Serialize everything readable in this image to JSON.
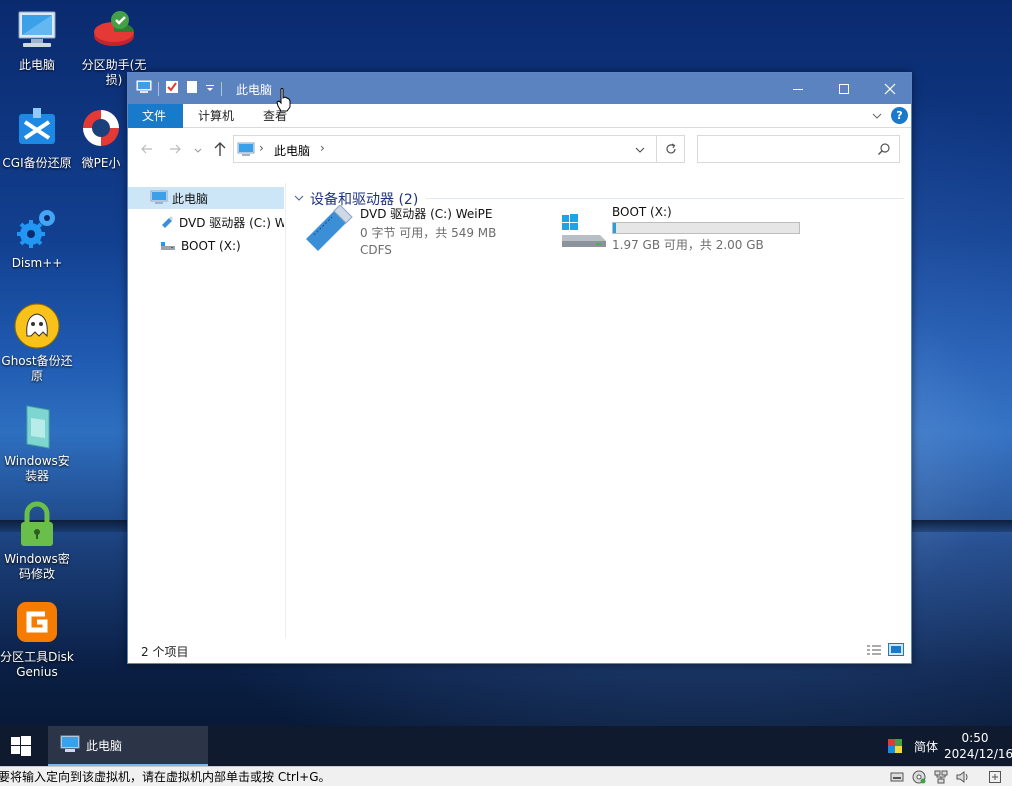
{
  "desktop": {
    "icons": [
      {
        "label": "此电脑",
        "icon": "computer-icon"
      },
      {
        "label": "分区助手(无损)",
        "icon": "partition-assistant-icon"
      },
      {
        "label": "CGI备份还原",
        "icon": "cgi-backup-icon"
      },
      {
        "label": "微PE小",
        "icon": "lifebuoy-icon"
      },
      {
        "label": "Dism++",
        "icon": "gears-icon"
      },
      {
        "label": "Ghost备份还原",
        "icon": "ghost-icon"
      },
      {
        "label": "Windows安装器",
        "icon": "windows-installer-icon"
      },
      {
        "label": "Windows密码修改",
        "icon": "padlock-icon"
      },
      {
        "label": "分区工具DiskGenius",
        "icon": "diskgenius-icon"
      }
    ]
  },
  "window": {
    "title": "此电脑",
    "controls": {
      "minimize": "minimize-icon",
      "maximize": "maximize-icon",
      "close": "close-icon"
    },
    "ribbon_tabs": [
      "文件",
      "计算机",
      "查看"
    ],
    "address": {
      "path": "此电脑"
    },
    "search": {
      "placeholder": ""
    },
    "nav_pane": [
      {
        "label": "此电脑",
        "icon": "computer-icon",
        "selected": true
      },
      {
        "label": "DVD 驱动器 (C:) W",
        "icon": "usb-drive-icon"
      },
      {
        "label": "BOOT (X:)",
        "icon": "drive-icon"
      }
    ],
    "group_header": "设备和驱动器 (2)",
    "drives": [
      {
        "name": "DVD 驱动器 (C:) WeiPE",
        "line2": "0 字节 可用，共 549 MB",
        "line3": "CDFS",
        "icon": "usb-drive-icon"
      },
      {
        "name": "BOOT (X:)",
        "line2": "1.97 GB 可用，共 2.00 GB",
        "icon": "windows-drive-icon",
        "used_fraction": 0.015
      }
    ],
    "status": "2 个项目"
  },
  "taskbar": {
    "app_label": "此电脑",
    "ime": "简体",
    "time": "0:50",
    "date": "2024/12/16"
  },
  "vm_hint": "要将输入定向到该虚拟机，请在虚拟机内部单击或按 Ctrl+G。",
  "colors": {
    "accent": "#1979ca",
    "titlebar": "#5b83bf",
    "selection": "#cde6f7",
    "group_header": "#1e3287"
  }
}
